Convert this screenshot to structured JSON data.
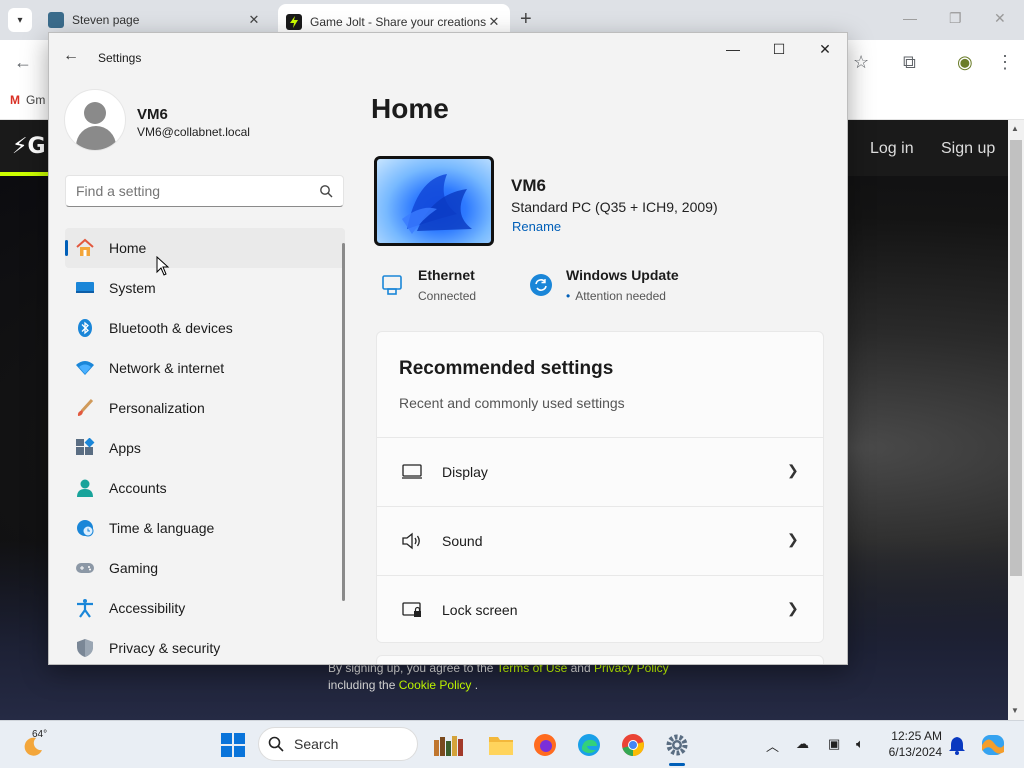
{
  "browser": {
    "tabs": [
      {
        "title": "Steven page",
        "close": "✕"
      },
      {
        "title": "Game Jolt - Share your creations",
        "close": "✕"
      }
    ],
    "new_tab": "+",
    "bookmark_gmail": "Gm"
  },
  "website": {
    "logo": "⚡G",
    "login": "Log in",
    "signup": "Sign up",
    "footer_pre": "By signing up, you agree to the",
    "terms": "Terms of Use",
    "and": "and",
    "privacy": "Privacy Policy",
    "footer_line2_pre": "including the",
    "cookie": "Cookie Policy",
    "period": "."
  },
  "settings": {
    "app_title": "Settings",
    "user": {
      "name": "VM6",
      "email": "VM6@collabnet.local"
    },
    "search_placeholder": "Find a setting",
    "nav": [
      {
        "label": "Home",
        "icon": "home-icon",
        "active": true
      },
      {
        "label": "System",
        "icon": "system-icon"
      },
      {
        "label": "Bluetooth & devices",
        "icon": "bluetooth-icon"
      },
      {
        "label": "Network & internet",
        "icon": "wifi-icon"
      },
      {
        "label": "Personalization",
        "icon": "brush-icon"
      },
      {
        "label": "Apps",
        "icon": "apps-icon"
      },
      {
        "label": "Accounts",
        "icon": "account-icon"
      },
      {
        "label": "Time & language",
        "icon": "globe-clock-icon"
      },
      {
        "label": "Gaming",
        "icon": "gamepad-icon"
      },
      {
        "label": "Accessibility",
        "icon": "accessibility-icon"
      },
      {
        "label": "Privacy & security",
        "icon": "shield-icon"
      }
    ],
    "page_title": "Home",
    "device": {
      "name": "VM6",
      "spec": "Standard PC (Q35 + ICH9, 2009)",
      "rename": "Rename"
    },
    "status": [
      {
        "title": "Ethernet",
        "sub": "Connected",
        "icon": "ethernet-icon"
      },
      {
        "title": "Windows Update",
        "sub": "Attention needed",
        "icon": "update-icon"
      }
    ],
    "recommended": {
      "title": "Recommended settings",
      "subtitle": "Recent and commonly used settings",
      "items": [
        {
          "label": "Display",
          "icon": "display-icon"
        },
        {
          "label": "Sound",
          "icon": "speaker-icon"
        },
        {
          "label": "Lock screen",
          "icon": "lock-screen-icon"
        }
      ]
    }
  },
  "taskbar": {
    "weather_temp": "64°",
    "search_label": "Search",
    "time": "12:25 AM",
    "date": "6/13/2024"
  },
  "colors": {
    "accent": "#005fb8",
    "site_link": "#c6ff00"
  }
}
